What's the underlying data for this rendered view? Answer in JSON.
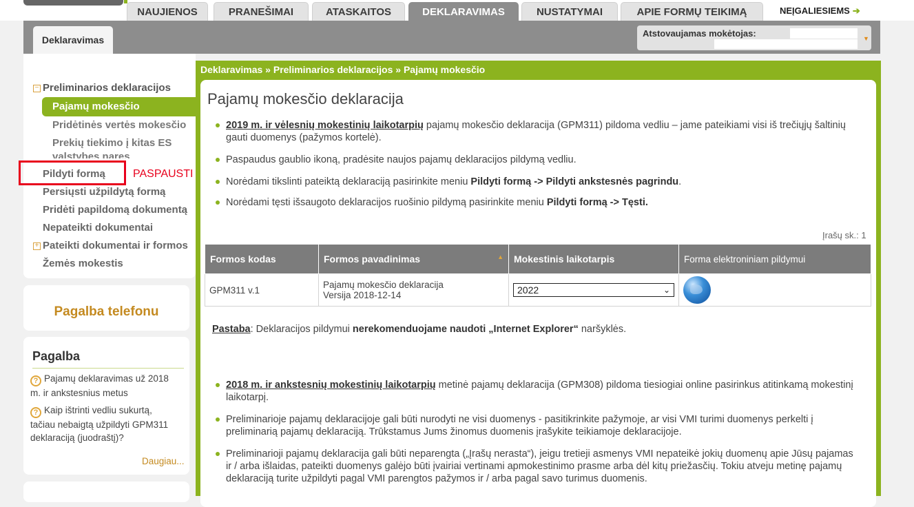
{
  "header": {
    "tabs": [
      "NAUJIENOS",
      "PRANEŠIMAI",
      "ATASKAITOS",
      "DEKLARAVIMAS",
      "NUSTATYMAI",
      "APIE FORMŲ TEIKIMĄ"
    ],
    "accessibility_link": "NEĮGALIESIEMS",
    "section_tab": "Deklaravimas",
    "payer_label": "Atstovaujamas mokėtojas:"
  },
  "sidebar": {
    "group1": "Preliminarios deklaracijos",
    "active_item": "Pajamų mokesčio",
    "sub_items": [
      "Pridėtinės vertės mokesčio",
      "Prekių tiekimo į kitas ES valstybes nares"
    ],
    "items": [
      "Pildyti formą",
      "Persiųsti užpildytą formą",
      "Pridėti papildomą dokumentą",
      "Nepateikti dokumentai"
    ],
    "group2": "Pateikti dokumentai ir formos",
    "last_item": "Žemės mokestis",
    "annotation": "PASPAUSTI",
    "phone_help": "Pagalba telefonu",
    "help_title": "Pagalba",
    "help_links": [
      "Pajamų deklaravimas už 2018 m. ir ankstesnius metus",
      "Kaip ištrinti vedliu sukurtą, tačiau nebaigtą užpildyti GPM311 deklaraciją (juodraštį)?"
    ],
    "more": "Daugiau..."
  },
  "main": {
    "breadcrumb": [
      "Deklaravimas »",
      "Preliminarios deklaracijos",
      "» Pajamų mokesčio"
    ],
    "title": "Pajamų mokesčio deklaracija",
    "b1_link": "2019 m. ir vėlesnių mokestinių laikotarpių",
    "b1_text": " pajamų mokesčio deklaracija (GPM311) pildoma vedliu – jame pateikiami visi iš trečiųjų šaltinių gauti duomenys (pažymos kortelė).",
    "b2_text": "Paspaudus gaublio ikoną, pradėsite naujos pajamų deklaracijos pildymą vedliu.",
    "b3_pre": "Norėdami tikslinti pateiktą deklaraciją pasirinkite meniu ",
    "b3_bold": "Pildyti formą -> Pildyti ankstesnės pagrindu",
    "b4_pre": "Norėdami tęsti išsaugoto deklaracijos ruošinio pildymą pasirinkite meniu ",
    "b4_bold": "Pildyti formą -> Tęsti.",
    "record_count": "Įrašų sk.: 1",
    "table": {
      "headers": [
        "Formos kodas",
        "Formos pavadinimas",
        "Mokestinis laikotarpis",
        "Forma elektroniniam pildymui"
      ],
      "row": {
        "code": "GPM311 v.1",
        "name": "Pajamų mokesčio deklaracija",
        "version": "Versija 2018-12-14",
        "period": "2022"
      }
    },
    "note_label": "Pastaba",
    "note_pre": ": Deklaracijos pildymui ",
    "note_bold": "nerekomenduojame naudoti „Internet Explorer“",
    "note_post": " naršyklės.",
    "c1_link": "2018 m. ir ankstesnių mokestinių laikotarpių",
    "c1_text": " metinė pajamų deklaracija (GPM308) pildoma tiesiogiai online pasirinkus atitinkamą mokestinį laikotarpį.",
    "c2_text": "Preliminarioje pajamų deklaracijoje gali būti nurodyti ne visi duomenys - pasitikrinkite pažymoje, ar visi VMI turimi duomenys perkelti į preliminarią pajamų deklaraciją. Trūkstamus Jums žinomus duomenis įrašykite teikiamoje deklaracijoje.",
    "c3_text": "Preliminarioji pajamų deklaracija gali būti neparengta („Įrašų nerasta“), jeigu tretieji asmenys VMI nepateikė jokių duomenų apie Jūsų pajamas ir / arba išlaidas, pateikti duomenys galėjo būti įvairiai vertinami apmokestinimo prasme arba dėl kitų priežasčių. Tokiu atveju metinę pajamų deklaraciją turite užpildyti pagal VMI parengtos pažymos ir / arba pagal savo turimus duomenis."
  }
}
